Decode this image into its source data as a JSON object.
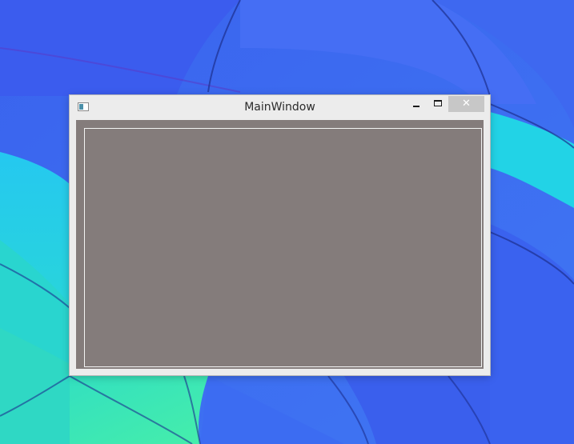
{
  "window": {
    "title": "MainWindow",
    "controls": {
      "close_glyph": "✕"
    }
  },
  "icons": {
    "app": "app-window-icon",
    "minimize": "minimize-icon",
    "maximize": "maximize-icon",
    "close": "close-icon"
  },
  "colors": {
    "desktop_blue": "#3c6df0",
    "desktop_cyan": "#1fd6e8",
    "desktop_green": "#35e6b4",
    "titlebar": "#ececec",
    "close_button": "#c7c7c7",
    "client_area": "#847c7b",
    "client_frame": "#f3f3f3"
  }
}
